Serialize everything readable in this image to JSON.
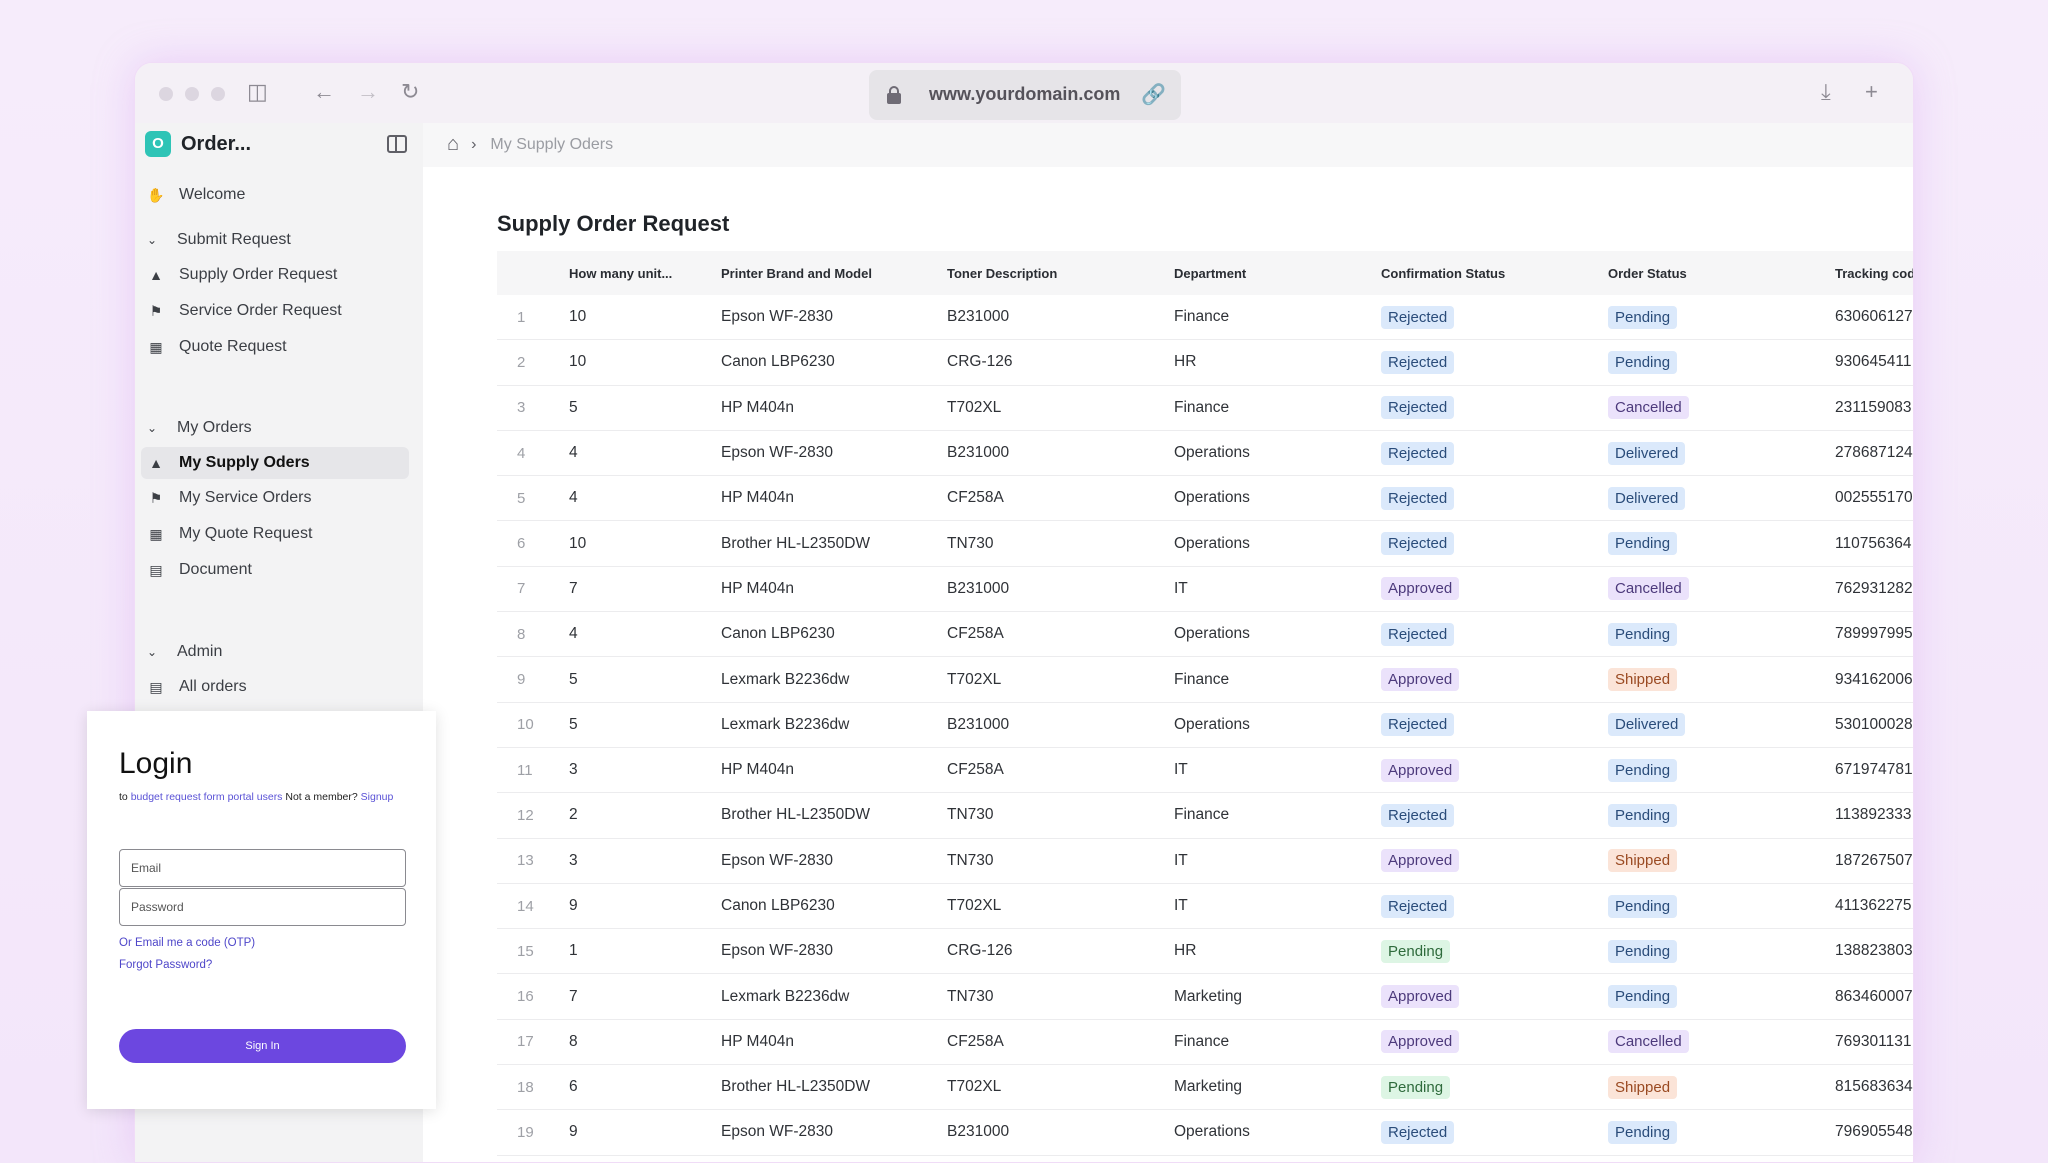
{
  "browser": {
    "url": "www.yourdomain.com"
  },
  "app": {
    "logo_letter": "O",
    "name": "Order..."
  },
  "sidebar": {
    "welcome": "Welcome",
    "sections": [
      {
        "label": "Submit Request"
      },
      {
        "label": "My Orders"
      },
      {
        "label": "Admin"
      }
    ],
    "submit_items": [
      {
        "label": "Supply Order Request",
        "icon": "basket-icon"
      },
      {
        "label": "Service Order Request",
        "icon": "flag-icon"
      },
      {
        "label": "Quote Request",
        "icon": "message-icon"
      }
    ],
    "order_items": [
      {
        "label": "My Supply Oders",
        "icon": "basket-icon",
        "active": true
      },
      {
        "label": "My Service Orders",
        "icon": "flag-icon"
      },
      {
        "label": "My Quote Request",
        "icon": "message-icon"
      },
      {
        "label": "Document",
        "icon": "document-icon"
      }
    ],
    "admin_items": [
      {
        "label": "All orders",
        "icon": "document-icon"
      }
    ]
  },
  "breadcrumb": {
    "current": "My Supply Oders"
  },
  "main": {
    "title": "Supply Order Request",
    "columns": [
      "",
      "How many unit...",
      "Printer Brand and Model",
      "Toner Description",
      "Department",
      "Confirmation Status",
      "Order Status",
      "Tracking code"
    ],
    "rows": [
      [
        "1",
        "10",
        "Epson WF-2830",
        "B231000",
        "Finance",
        "Rejected",
        "Pending",
        "630606127"
      ],
      [
        "2",
        "10",
        "Canon LBP6230",
        "CRG-126",
        "HR",
        "Rejected",
        "Pending",
        "930645411"
      ],
      [
        "3",
        "5",
        "HP M404n",
        "T702XL",
        "Finance",
        "Rejected",
        "Cancelled",
        "231159083"
      ],
      [
        "4",
        "4",
        "Epson WF-2830",
        "B231000",
        "Operations",
        "Rejected",
        "Delivered",
        "278687124"
      ],
      [
        "5",
        "4",
        "HP M404n",
        "CF258A",
        "Operations",
        "Rejected",
        "Delivered",
        "002555170"
      ],
      [
        "6",
        "10",
        "Brother HL-L2350DW",
        "TN730",
        "Operations",
        "Rejected",
        "Pending",
        "110756364"
      ],
      [
        "7",
        "7",
        "HP M404n",
        "B231000",
        "IT",
        "Approved",
        "Cancelled",
        "762931282"
      ],
      [
        "8",
        "4",
        "Canon LBP6230",
        "CF258A",
        "Operations",
        "Rejected",
        "Pending",
        "789997995"
      ],
      [
        "9",
        "5",
        "Lexmark B2236dw",
        "T702XL",
        "Finance",
        "Approved",
        "Shipped",
        "934162006"
      ],
      [
        "10",
        "5",
        "Lexmark B2236dw",
        "B231000",
        "Operations",
        "Rejected",
        "Delivered",
        "530100028"
      ],
      [
        "11",
        "3",
        "HP M404n",
        "CF258A",
        "IT",
        "Approved",
        "Pending",
        "671974781"
      ],
      [
        "12",
        "2",
        "Brother HL-L2350DW",
        "TN730",
        "Finance",
        "Rejected",
        "Pending",
        "113892333"
      ],
      [
        "13",
        "3",
        "Epson WF-2830",
        "TN730",
        "IT",
        "Approved",
        "Shipped",
        "187267507"
      ],
      [
        "14",
        "9",
        "Canon LBP6230",
        "T702XL",
        "IT",
        "Rejected",
        "Pending",
        "411362275"
      ],
      [
        "15",
        "1",
        "Epson WF-2830",
        "CRG-126",
        "HR",
        "Pending",
        "Pending",
        "138823803"
      ],
      [
        "16",
        "7",
        "Lexmark B2236dw",
        "TN730",
        "Marketing",
        "Approved",
        "Pending",
        "863460007"
      ],
      [
        "17",
        "8",
        "HP M404n",
        "CF258A",
        "Finance",
        "Approved",
        "Cancelled",
        "769301131"
      ],
      [
        "18",
        "6",
        "Brother HL-L2350DW",
        "T702XL",
        "Marketing",
        "Pending",
        "Shipped",
        "815683634"
      ],
      [
        "19",
        "9",
        "Epson WF-2830",
        "B231000",
        "Operations",
        "Rejected",
        "Pending",
        "796905548"
      ]
    ]
  },
  "login": {
    "title": "Login",
    "sub_prefix": "to",
    "sub_link": "budget request form portal users",
    "not_member": "Not a member?",
    "signup": "Signup",
    "email_placeholder": "Email",
    "password_placeholder": "Password",
    "otp_link": "Or Email me a code (OTP)",
    "forgot_link": "Forgot Password?",
    "sign_in": "Sign In"
  },
  "colors": {
    "accent": "#6c47e0",
    "logo": "#2ec4b6",
    "badge_blue": "#dbe9fb",
    "badge_purple": "#ebe2fb",
    "badge_orange": "#fbe4d8",
    "badge_green": "#ddf5e4"
  }
}
